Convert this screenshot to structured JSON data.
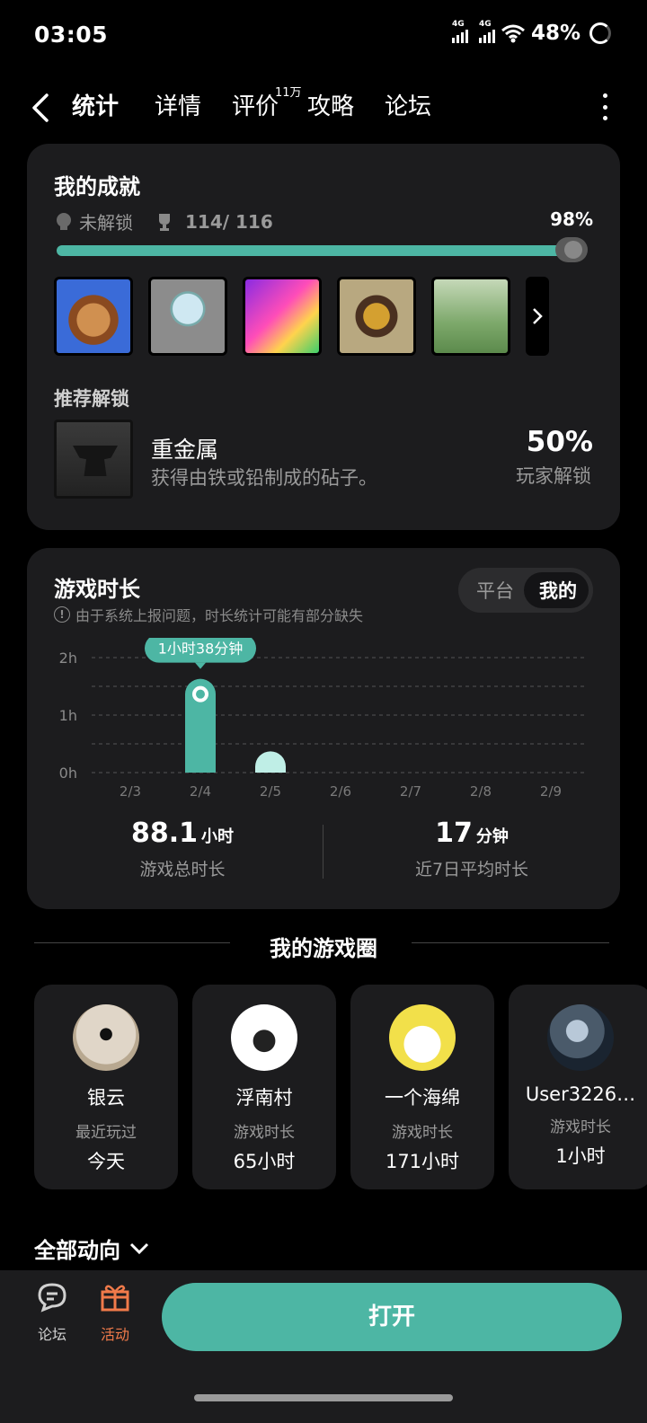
{
  "status": {
    "time": "03:05",
    "net1": "4G",
    "net2": "4G",
    "battery": "48%"
  },
  "nav": {
    "tabs": [
      "统计",
      "详情",
      "评价",
      "攻略",
      "论坛"
    ],
    "review_badge": "11万"
  },
  "achievements": {
    "title": "我的成就",
    "locked_label": "未解锁",
    "count": "114/ 116",
    "percent": "98%",
    "progress": 0.98,
    "icons": [
      "achievement-icon-1",
      "achievement-icon-2",
      "achievement-icon-3",
      "achievement-icon-4",
      "achievement-icon-5"
    ],
    "recommend_label": "推荐解锁",
    "recommend": {
      "name": "重金属",
      "desc": "获得由铁或铅制成的砧子。",
      "percent": "50%",
      "percent_label": "玩家解锁"
    }
  },
  "playtime": {
    "title": "游戏时长",
    "notice": "由于系统上报问题，时长统计可能有部分缺失",
    "toggle_off": "平台",
    "toggle_on": "我的",
    "tooltip": "1小时38分钟",
    "total_value": "88.1",
    "total_unit": "小时",
    "total_label": "游戏总时长",
    "avg_value": "17",
    "avg_unit": "分钟",
    "avg_label": "近7日平均时长"
  },
  "chart_data": {
    "type": "bar",
    "categories": [
      "2/3",
      "2/4",
      "2/5",
      "2/6",
      "2/7",
      "2/8",
      "2/9"
    ],
    "values": [
      0,
      1.63,
      0.37,
      0,
      0,
      0,
      0
    ],
    "y_ticks": [
      "0h",
      "1h",
      "2h"
    ],
    "ylim": [
      0,
      2
    ],
    "highlight_index": 1,
    "colors": {
      "highlight": "#4db6a4",
      "normal": "#bfeee6"
    }
  },
  "circle": {
    "title": "我的游戏圈",
    "friends": [
      {
        "name": "银云",
        "sub": "最近玩过",
        "value": "今天"
      },
      {
        "name": "浮南村",
        "sub": "游戏时长",
        "value": "65小时"
      },
      {
        "name": "一个海绵",
        "sub": "游戏时长",
        "value": "171小时"
      },
      {
        "name": "User3226…",
        "sub": "游戏时长",
        "value": "1小时"
      }
    ]
  },
  "all_updates": "全部动向",
  "bottom": {
    "forum": "论坛",
    "activity": "活动",
    "open": "打开"
  },
  "colors": {
    "accent": "#4db6a4",
    "activity": "#f07a4a"
  }
}
